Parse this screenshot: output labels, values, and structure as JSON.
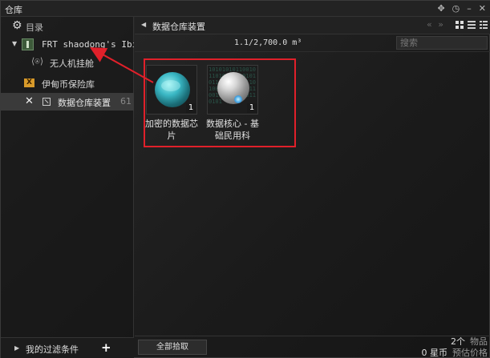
{
  "window": {
    "title": "仓库"
  },
  "left": {
    "directory_label": "目录",
    "ship": {
      "name": "FRT shaodong's Ibis",
      "count": "("
    },
    "drone_bay": "无人机挂舱",
    "isk_vault": "伊甸币保险库",
    "data_container": {
      "name": "数据仓库装置",
      "count": "61"
    },
    "filter_label": "我的过滤条件"
  },
  "right": {
    "breadcrumb": "数据仓库装置",
    "nav": "« »",
    "capacity": "1.1/2,700.0 m³",
    "search_placeholder": "搜索",
    "items": [
      {
        "name": "加密的数据芯片",
        "qty": "1",
        "icon": "encrypted-data-chip"
      },
      {
        "name": "数据核心 - 基础民用科",
        "qty": "1",
        "icon": "datacore-sphere"
      }
    ],
    "pickup_all": "全部拾取",
    "stats": {
      "item_count": "2个",
      "item_count_label": "物品",
      "value": "0 星币",
      "value_label": "预估价格"
    }
  },
  "colors": {
    "highlight": "#e0202a",
    "accent_orange": "#d89a2a"
  }
}
